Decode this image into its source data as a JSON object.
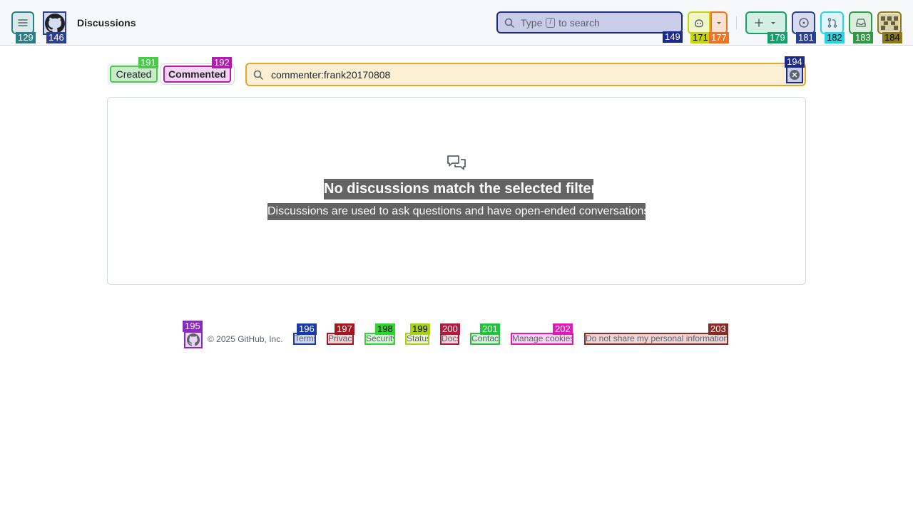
{
  "header": {
    "title": "Discussions",
    "search": {
      "prefix": "Type",
      "key": "/",
      "suffix": "to search"
    }
  },
  "filters": {
    "created_label": "Created",
    "commented_label": "Commented",
    "query": "commenter:frank20170808"
  },
  "blank_state": {
    "title": "No discussions match the selected filters.",
    "description": "Discussions are used to ask questions and have open-ended conversations."
  },
  "footer": {
    "copyright": "© 2025 GitHub, Inc.",
    "links": [
      "Terms",
      "Privacy",
      "Security",
      "Status",
      "Docs",
      "Contact",
      "Manage cookies",
      "Do not share my personal information"
    ]
  },
  "overlay_tags": {
    "menu": "129",
    "logo": "146",
    "search": "149",
    "copilot": "171",
    "copilot_drop": "177",
    "create": "179",
    "issues": "181",
    "prs": "182",
    "inbox": "183",
    "avatar": "184",
    "created": "191",
    "commented": "192",
    "clear": "194",
    "footer_logo": "195",
    "terms": "196",
    "privacy": "197",
    "security": "198",
    "status": "199",
    "docs": "200",
    "contact": "201",
    "cookies": "202",
    "donotshare": "203"
  },
  "colors": {
    "accent_blue": "#1b2a8a",
    "bg_header": "#f6f8fa",
    "border": "#d1d9e0",
    "muted_text": "#59636e"
  }
}
